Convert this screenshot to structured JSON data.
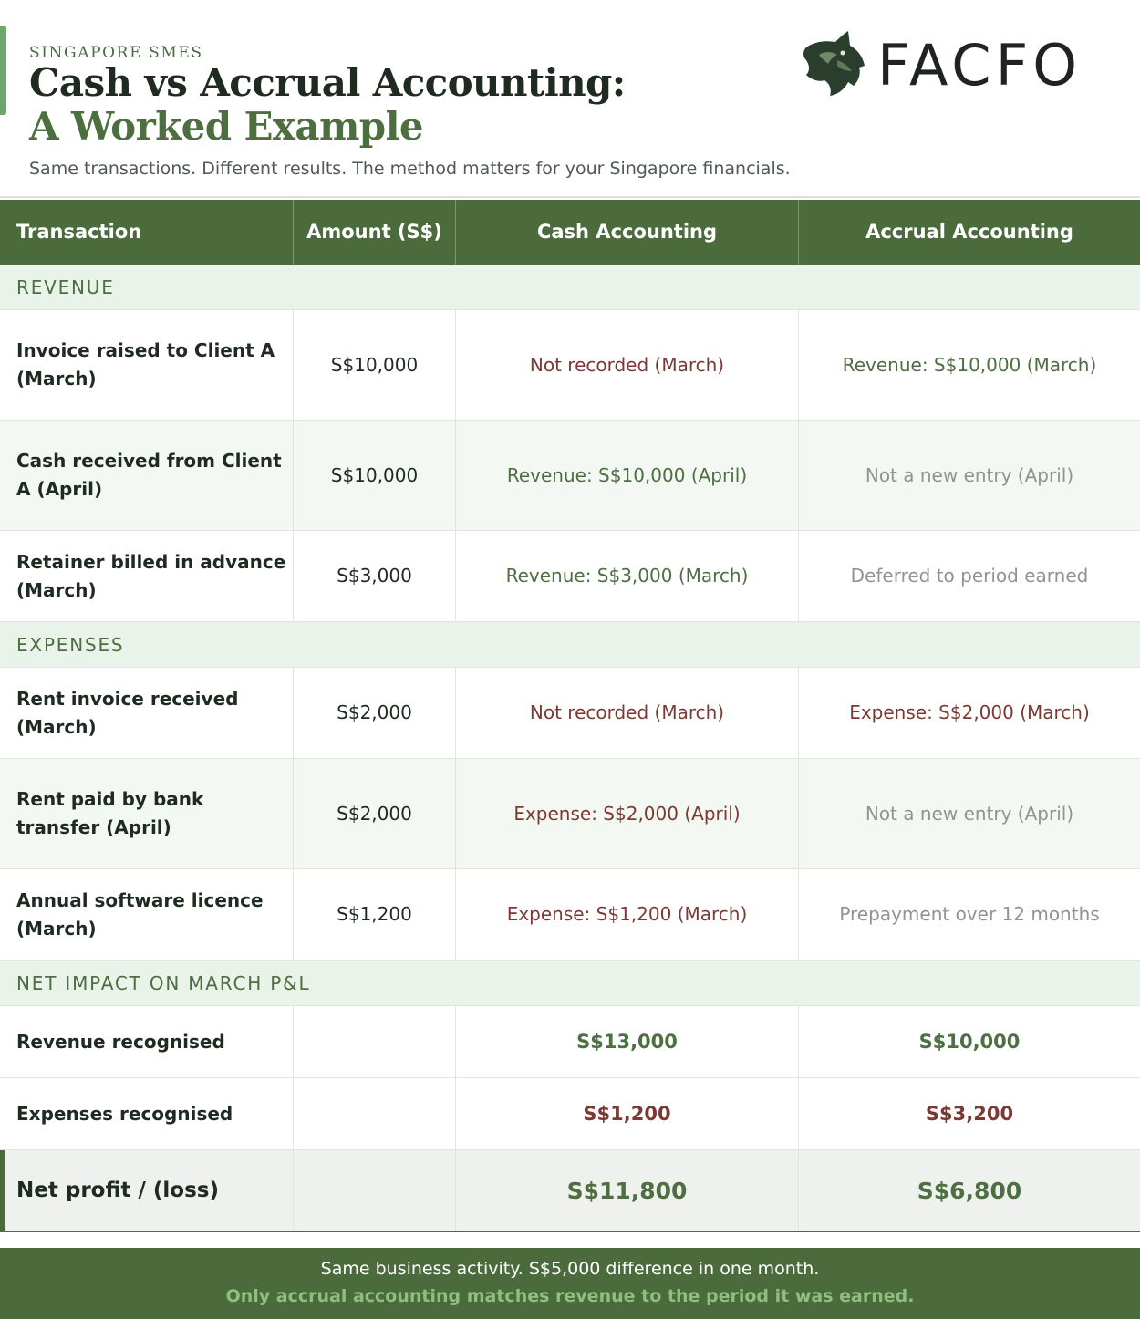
{
  "header": {
    "eyebrow": "SINGAPORE SMES",
    "title_line1": "Cash vs Accrual Accounting:",
    "title_line2": "A Worked Example",
    "subtitle": "Same transactions. Different results. The method matters for your Singapore financials."
  },
  "logo": {
    "icon": "lynx-head-icon",
    "text": "FACFO"
  },
  "table": {
    "columns": [
      "Transaction",
      "Amount (S$)",
      "Cash Accounting",
      "Accrual Accounting"
    ],
    "sections": [
      {
        "label": "REVENUE",
        "rows": [
          {
            "transaction": "Invoice raised to Client A (March)",
            "amount": "S$10,000",
            "cash": "Not recorded (March)",
            "accrual": "Revenue: S$10,000 (March)"
          },
          {
            "transaction": "Cash received from Client A (April)",
            "amount": "S$10,000",
            "cash": "Revenue: S$10,000 (April)",
            "accrual": "Not a new entry (April)"
          },
          {
            "transaction": "Retainer billed in advance (March)",
            "amount": "S$3,000",
            "cash": "Revenue: S$3,000 (March)",
            "accrual": "Deferred to period earned"
          }
        ]
      },
      {
        "label": "EXPENSES",
        "rows": [
          {
            "transaction": "Rent invoice received (March)",
            "amount": "S$2,000",
            "cash": "Not recorded (March)",
            "accrual": "Expense: S$2,000 (March)"
          },
          {
            "transaction": "Rent paid by bank transfer (April)",
            "amount": "S$2,000",
            "cash": "Expense: S$2,000 (April)",
            "accrual": "Not a new entry (April)"
          },
          {
            "transaction": "Annual software licence (March)",
            "amount": "S$1,200",
            "cash": "Expense: S$1,200 (March)",
            "accrual": "Prepayment over 12 months"
          }
        ]
      },
      {
        "label": "NET IMPACT ON MARCH P&L",
        "rows": [
          {
            "transaction": "Revenue recognised",
            "amount": "",
            "cash": "S$13,000",
            "accrual": "S$10,000"
          },
          {
            "transaction": "Expenses recognised",
            "amount": "",
            "cash": "S$1,200",
            "accrual": "S$3,200"
          },
          {
            "transaction": "Net profit / (loss)",
            "amount": "",
            "cash": "S$11,800",
            "accrual": "S$6,800"
          }
        ]
      }
    ]
  },
  "footer": {
    "line1": "Same business activity. S$5,000 difference in one month.",
    "line2": "Only accrual accounting matches revenue to the period it was earned."
  },
  "colors": {
    "brand_green": "#4b6b3d",
    "section_bg": "#eaf3ea",
    "expense_red": "#7a3a33",
    "neutral_grey": "#8c968f",
    "footer_highlight": "#8fbf7f"
  }
}
